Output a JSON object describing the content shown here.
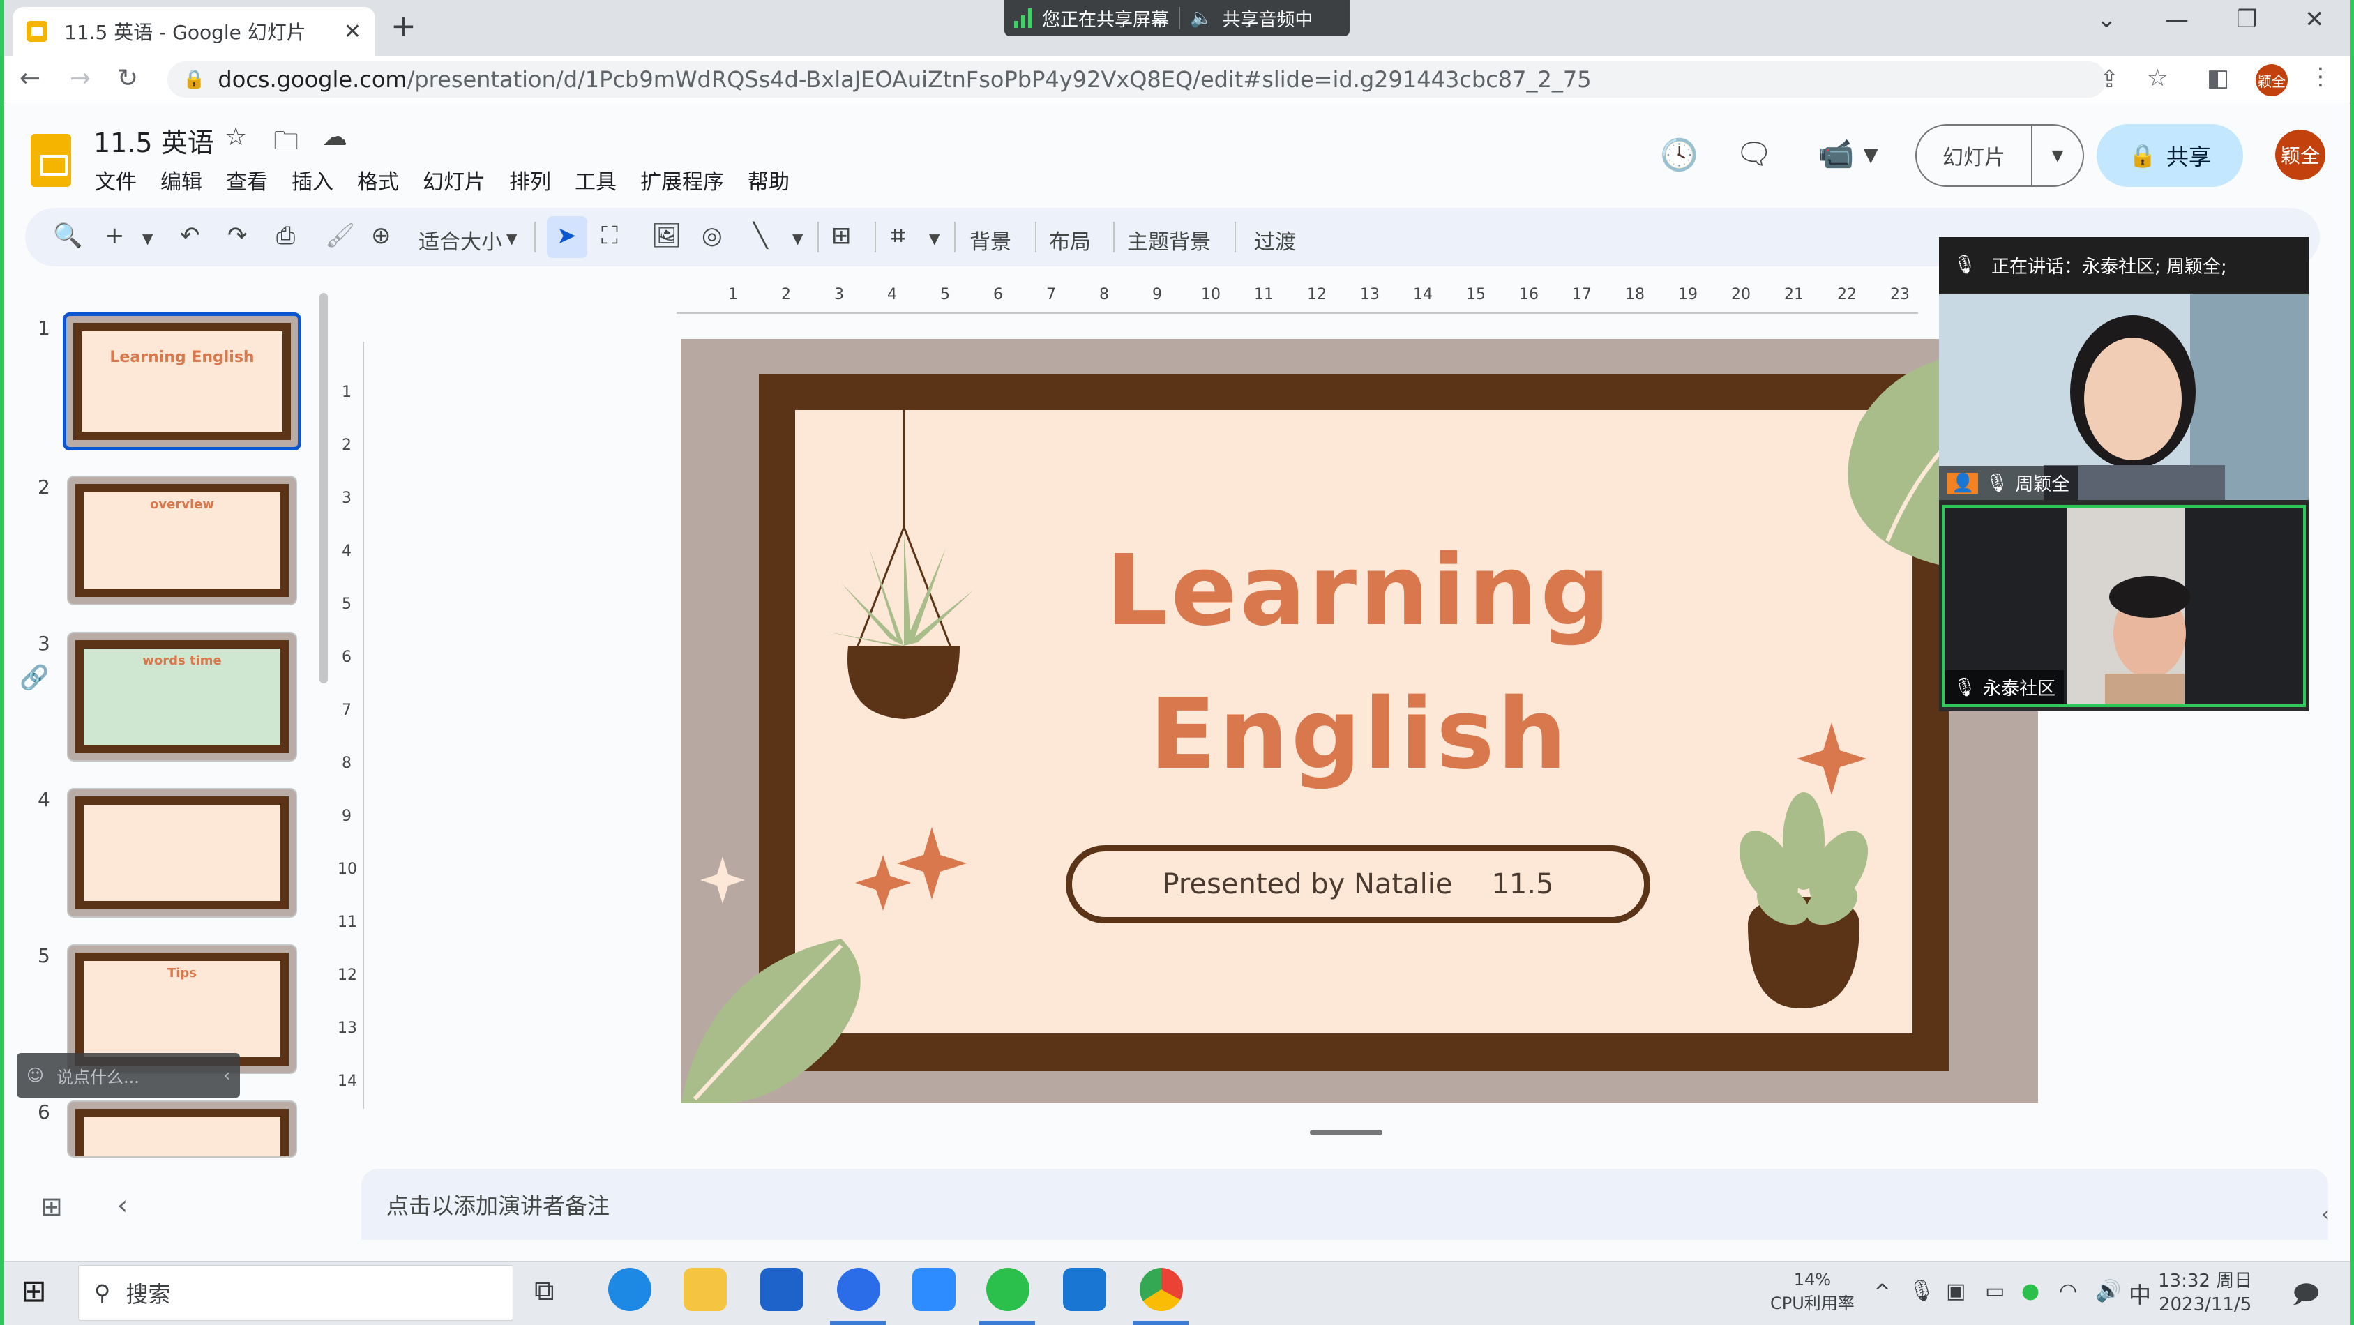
{
  "browser": {
    "tab_title": "11.5 英语 - Google 幻灯片",
    "tab_close": "✕",
    "new_tab": "+",
    "url_host": "docs.google.com",
    "url_path": "/presentation/d/1Pcb9mWdRQSs4d-BxlaJEOAuiZtnFsoPbP4y92VxQ8EQ/edit#slide=id.g291443cbc87_2_75",
    "profile_initials": "颖全"
  },
  "share_banner": {
    "screen_text": "您正在共享屏幕",
    "audio_text": "共享音频中"
  },
  "doc": {
    "title": "11.5 英语",
    "menu": [
      "文件",
      "编辑",
      "查看",
      "插入",
      "格式",
      "幻灯片",
      "排列",
      "工具",
      "扩展程序",
      "帮助"
    ],
    "slideshow_label": "幻灯片",
    "share_label": "共享",
    "account_initials": "颖全"
  },
  "toolbar": {
    "zoom_label": "适合大小",
    "background": "背景",
    "layout": "布局",
    "theme": "主题背景",
    "transition": "过渡"
  },
  "filmstrip": {
    "slides": [
      {
        "num": "1",
        "title": "Learning English"
      },
      {
        "num": "2",
        "title": "overview"
      },
      {
        "num": "3",
        "title": "words time"
      },
      {
        "num": "4",
        "title": ""
      },
      {
        "num": "5",
        "title": "Tips"
      },
      {
        "num": "6",
        "title": ""
      }
    ],
    "chat_placeholder": "说点什么..."
  },
  "slide": {
    "title_line1": "Learning",
    "title_line2": "English",
    "presenter": "Presented by Natalie",
    "date": "11.5"
  },
  "video_panel": {
    "speaking": "正在讲话：永泰社区; 周颖全;",
    "participant1": "周颖全",
    "participant2": "永泰社区"
  },
  "notes_placeholder": "点击以添加演讲者备注",
  "taskbar": {
    "search": "搜索",
    "cpu_percent": "14%",
    "cpu_label": "CPU利用率",
    "ime": "中",
    "time": "13:32 周日",
    "date": "2023/11/5"
  },
  "colors": {
    "slide_orange": "#d9774d",
    "slide_brown": "#5b3316",
    "slide_cream": "#fde8d8",
    "share_blue": "#c2e7ff",
    "zoom_green": "#2ec85a"
  }
}
